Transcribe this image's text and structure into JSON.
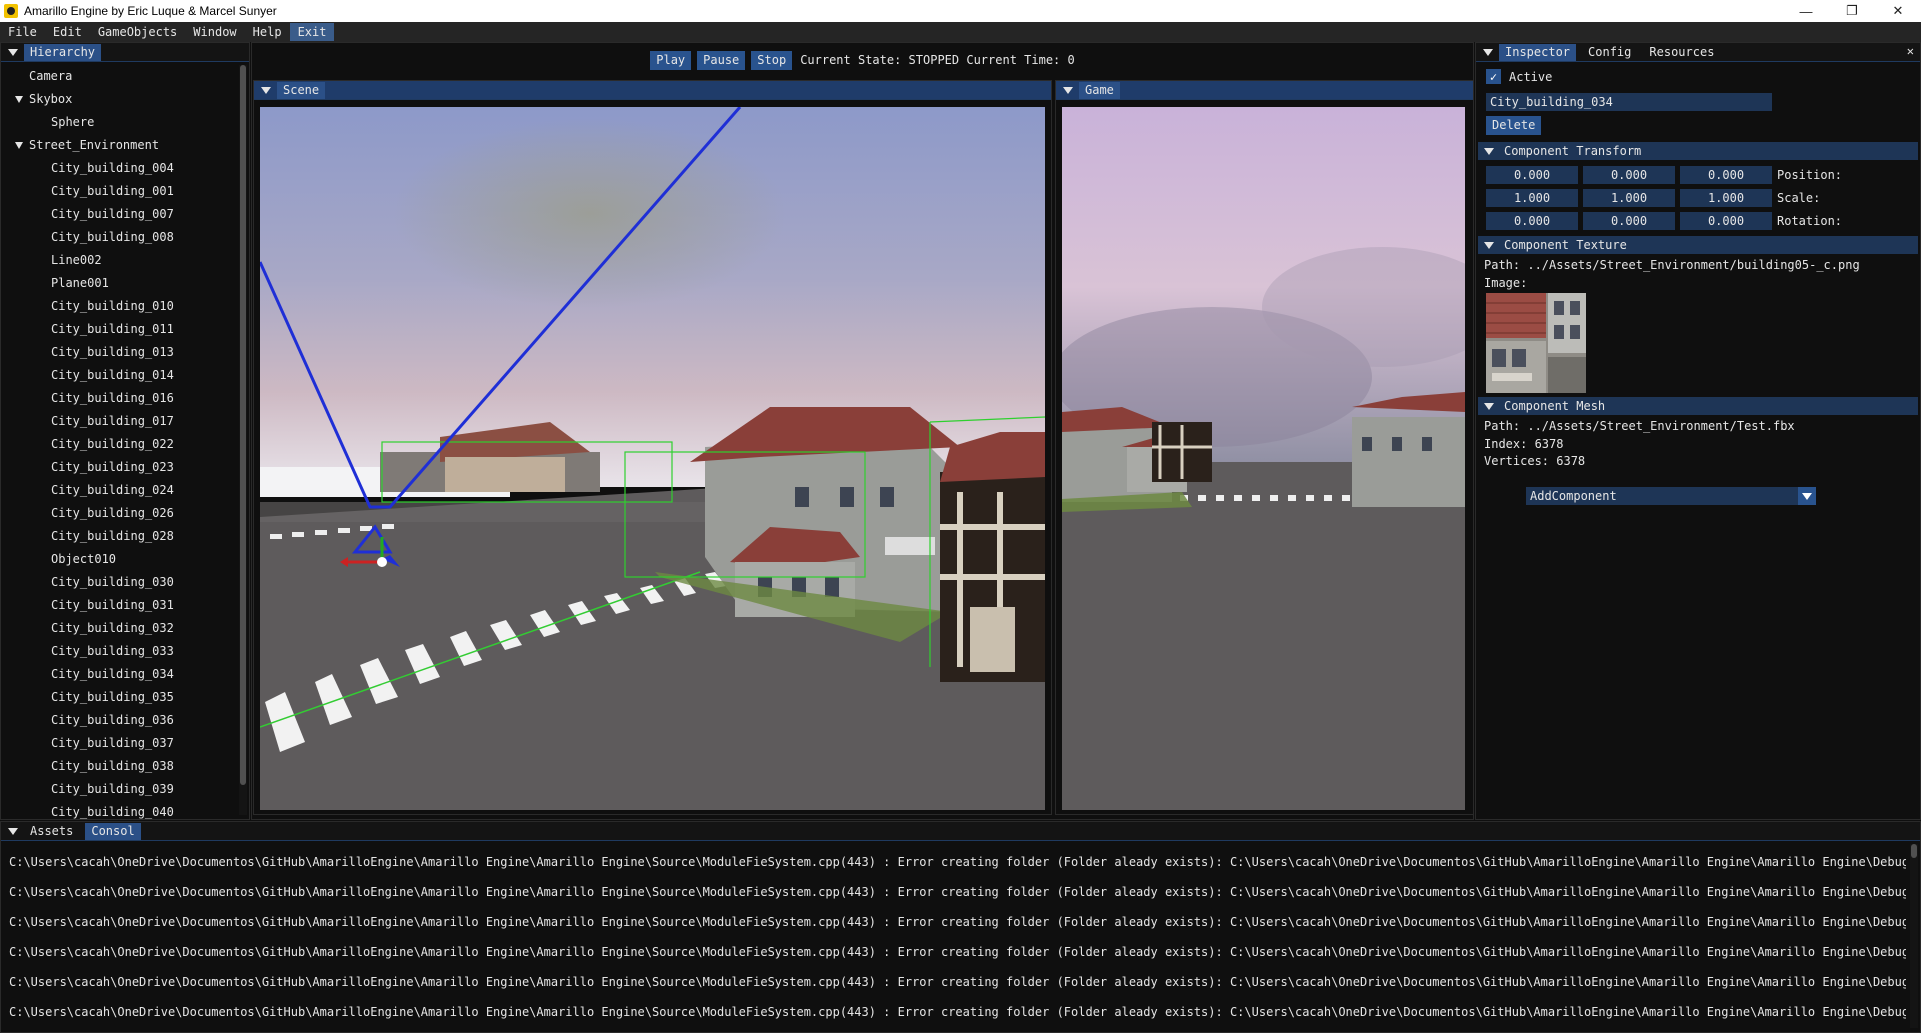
{
  "window": {
    "title": "Amarillo Engine by Eric Luque & Marcel Sunyer",
    "minimize": "—",
    "maximize": "❐",
    "close": "✕"
  },
  "menu": {
    "items": [
      "File",
      "Edit",
      "GameObjects",
      "Window",
      "Help",
      "Exit"
    ]
  },
  "hierarchy": {
    "tab": "Hierarchy",
    "items": [
      {
        "label": "Camera",
        "level": 1
      },
      {
        "label": "Skybox",
        "level": 0,
        "expanded": true
      },
      {
        "label": "Sphere",
        "level": 2
      },
      {
        "label": "Street_Environment",
        "level": 0,
        "expanded": true
      },
      {
        "label": "City_building_004",
        "level": 2
      },
      {
        "label": "City_building_001",
        "level": 2
      },
      {
        "label": "City_building_007",
        "level": 2
      },
      {
        "label": "City_building_008",
        "level": 2
      },
      {
        "label": "Line002",
        "level": 2
      },
      {
        "label": "Plane001",
        "level": 2
      },
      {
        "label": "City_building_010",
        "level": 2
      },
      {
        "label": "City_building_011",
        "level": 2
      },
      {
        "label": "City_building_013",
        "level": 2
      },
      {
        "label": "City_building_014",
        "level": 2
      },
      {
        "label": "City_building_016",
        "level": 2
      },
      {
        "label": "City_building_017",
        "level": 2
      },
      {
        "label": "City_building_022",
        "level": 2
      },
      {
        "label": "City_building_023",
        "level": 2
      },
      {
        "label": "City_building_024",
        "level": 2
      },
      {
        "label": "City_building_026",
        "level": 2
      },
      {
        "label": "City_building_028",
        "level": 2
      },
      {
        "label": "Object010",
        "level": 2
      },
      {
        "label": "City_building_030",
        "level": 2
      },
      {
        "label": "City_building_031",
        "level": 2
      },
      {
        "label": "City_building_032",
        "level": 2
      },
      {
        "label": "City_building_033",
        "level": 2
      },
      {
        "label": "City_building_034",
        "level": 2
      },
      {
        "label": "City_building_035",
        "level": 2
      },
      {
        "label": "City_building_036",
        "level": 2
      },
      {
        "label": "City_building_037",
        "level": 2
      },
      {
        "label": "City_building_038",
        "level": 2
      },
      {
        "label": "City_building_039",
        "level": 2
      },
      {
        "label": "City_building_040",
        "level": 2
      }
    ]
  },
  "toolbar": {
    "play": "Play",
    "pause": "Pause",
    "stop": "Stop",
    "state": "Current State: STOPPED Current Time: 0"
  },
  "scene": {
    "tab": "Scene"
  },
  "game": {
    "tab": "Game"
  },
  "inspector": {
    "tabs": [
      "Inspector",
      "Config",
      "Resources"
    ],
    "active_label": "Active",
    "name_value": "City_building_034",
    "delete_label": "Delete",
    "transform_title": "Component Transform",
    "position": [
      "0.000",
      "0.000",
      "0.000"
    ],
    "scale": [
      "1.000",
      "1.000",
      "1.000"
    ],
    "rotation": [
      "0.000",
      "0.000",
      "0.000"
    ],
    "position_label": "Position:",
    "scale_label": "Scale:",
    "rotation_label": "Rotation:",
    "texture_title": "Component Texture",
    "texture_path": "Path: ../Assets/Street_Environment/building05-_c.png",
    "image_label": "Image:",
    "mesh_title": "Component Mesh",
    "mesh_path": "Path: ../Assets/Street_Environment/Test.fbx",
    "mesh_index": "Index: 6378",
    "mesh_vertices": "Vertices: 6378",
    "add_component": "AddComponent"
  },
  "bottom": {
    "tabs": [
      "Assets",
      "Consol"
    ],
    "console_lines": [
      "C:\\Users\\cacah\\OneDrive\\Documentos\\GitHub\\AmarilloEngine\\Amarillo Engine\\Amarillo Engine\\Source\\ModuleFieSystem.cpp(443) : Error creating folder (Folder aleady exists): C:\\Users\\cacah\\OneDrive\\Documentos\\GitHub\\AmarilloEngine\\Amarillo Engine\\Amarillo Engine\\Debug\\Assets",
      "C:\\Users\\cacah\\OneDrive\\Documentos\\GitHub\\AmarilloEngine\\Amarillo Engine\\Amarillo Engine\\Source\\ModuleFieSystem.cpp(443) : Error creating folder (Folder aleady exists): C:\\Users\\cacah\\OneDrive\\Documentos\\GitHub\\AmarilloEngine\\Amarillo Engine\\Amarillo Engine\\Debug\\Library",
      "C:\\Users\\cacah\\OneDrive\\Documentos\\GitHub\\AmarilloEngine\\Amarillo Engine\\Amarillo Engine\\Source\\ModuleFieSystem.cpp(443) : Error creating folder (Folder aleady exists): C:\\Users\\cacah\\OneDrive\\Documentos\\GitHub\\AmarilloEngine\\Amarillo Engine\\Amarillo Engine\\Debug\\Library",
      "C:\\Users\\cacah\\OneDrive\\Documentos\\GitHub\\AmarilloEngine\\Amarillo Engine\\Amarillo Engine\\Source\\ModuleFieSystem.cpp(443) : Error creating folder (Folder aleady exists): C:\\Users\\cacah\\OneDrive\\Documentos\\GitHub\\AmarilloEngine\\Amarillo Engine\\Amarillo Engine\\Debug\\Library",
      "C:\\Users\\cacah\\OneDrive\\Documentos\\GitHub\\AmarilloEngine\\Amarillo Engine\\Amarillo Engine\\Source\\ModuleFieSystem.cpp(443) : Error creating folder (Folder aleady exists): C:\\Users\\cacah\\OneDrive\\Documentos\\GitHub\\AmarilloEngine\\Amarillo Engine\\Amarillo Engine\\Debug\\Library",
      "C:\\Users\\cacah\\OneDrive\\Documentos\\GitHub\\AmarilloEngine\\Amarillo Engine\\Amarillo Engine\\Source\\ModuleFieSystem.cpp(443) : Error creating folder (Folder aleady exists): C:\\Users\\cacah\\OneDrive\\Documentos\\GitHub\\AmarilloEngine\\Amarillo Engine\\Amarillo Engine\\Debug\\Library"
    ]
  },
  "colors": {
    "accent": "#29538e",
    "frame_bg": "#1e3556",
    "window_bg": "#0f0f0f"
  }
}
